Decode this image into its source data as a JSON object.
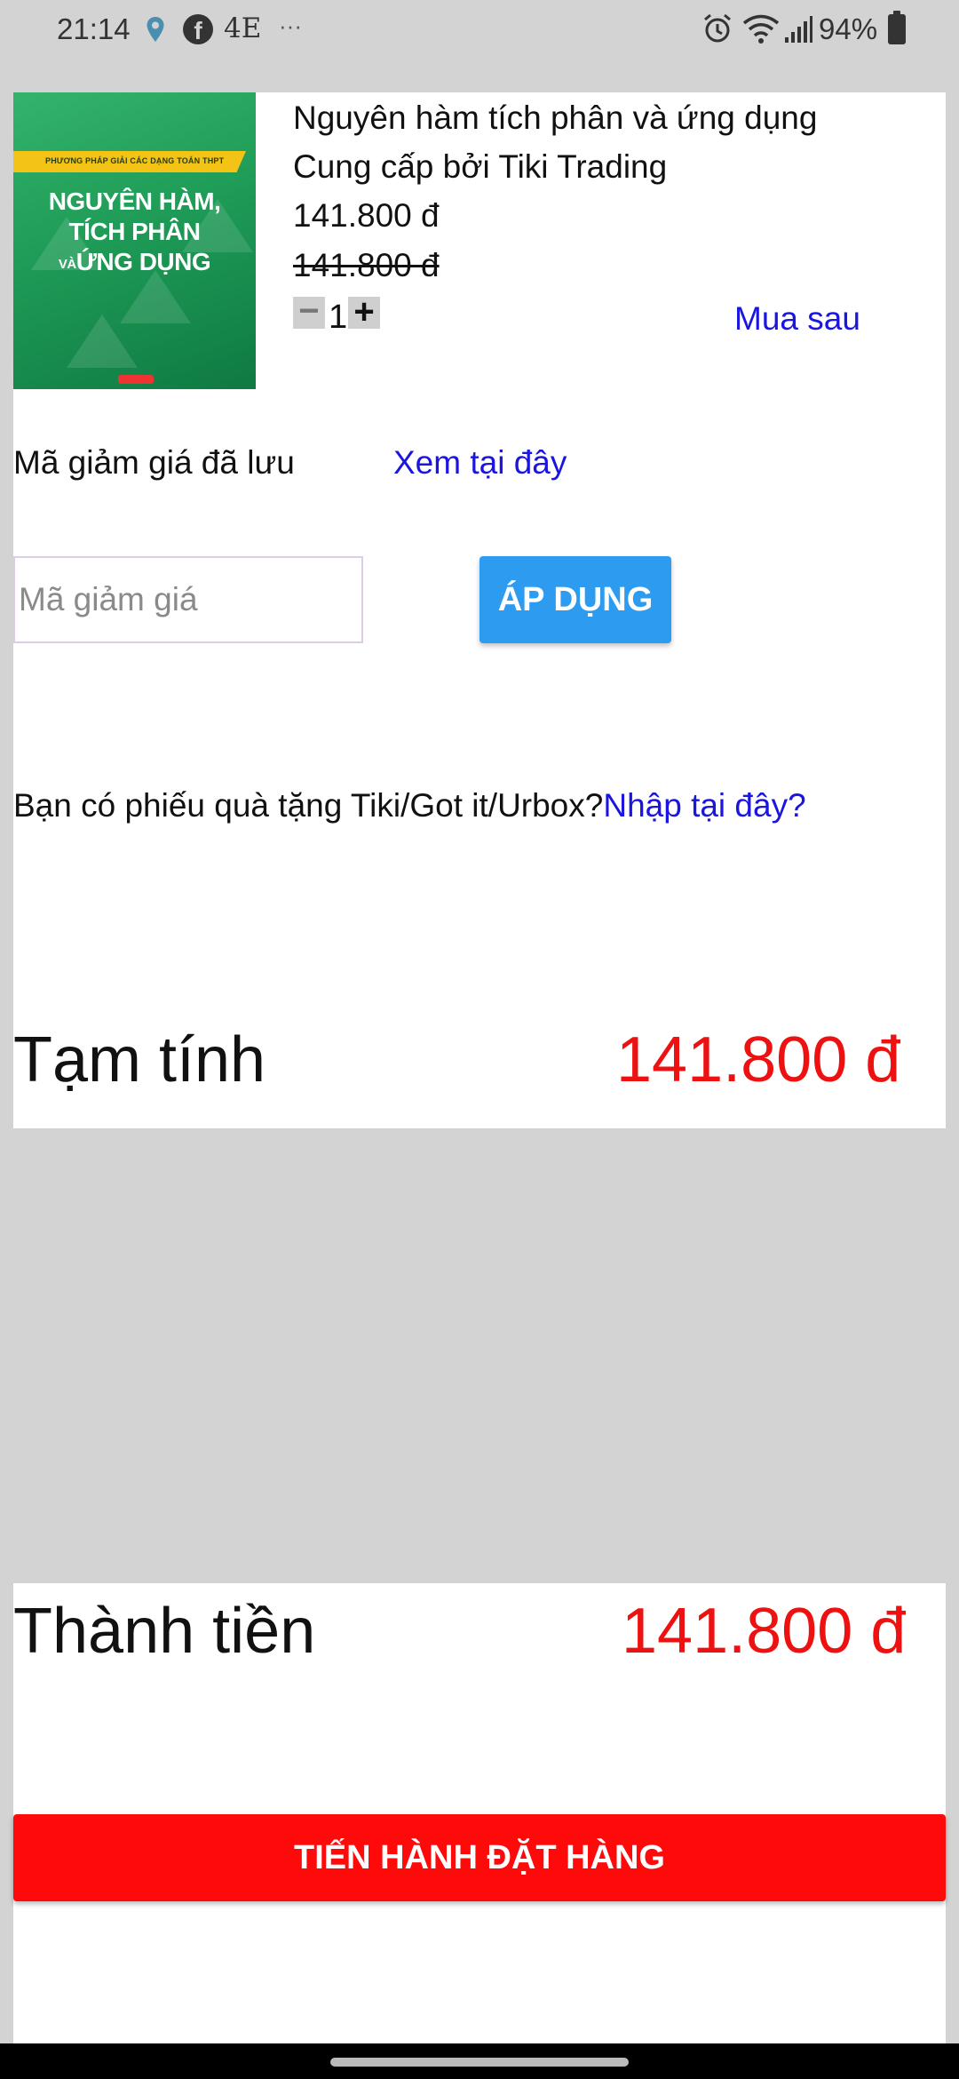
{
  "status_bar": {
    "time": "21:14",
    "network_label": "4E",
    "more": "···",
    "battery": "94%",
    "icons": [
      "location-icon",
      "facebook-icon",
      "alarm-icon",
      "wifi-icon",
      "signal-icon",
      "battery-icon"
    ]
  },
  "product": {
    "cover": {
      "band_text": "PHƯƠNG PHÁP GIẢI CÁC DẠNG TOÁN THPT",
      "title_line1": "NGUYÊN HÀM,",
      "title_line2": "TÍCH PHÂN",
      "title_line3_small": "VÀ",
      "title_line3": "ỨNG DỤNG"
    },
    "title": "Nguyên hàm tích phân và ứng dụng",
    "seller": "Cung cấp bởi Tiki Trading",
    "price": "141.800 đ",
    "original_price": "141.800 đ",
    "quantity": "1",
    "minus": "−",
    "plus": "+",
    "buy_later": "Mua sau"
  },
  "coupon": {
    "saved_label": "Mã giảm giá đã lưu",
    "saved_link": "Xem tại đây",
    "input_placeholder": "Mã giảm giá",
    "apply_label": "ÁP DỤNG"
  },
  "gift": {
    "text": "Bạn có phiếu quà tặng Tiki/Got it/Urbox?",
    "link": "Nhập tại đây?"
  },
  "subtotal": {
    "label": "Tạm tính",
    "value": "141.800 đ"
  },
  "total": {
    "label": "Thành tiền",
    "value": "141.800 đ"
  },
  "checkout": {
    "label": "TIẾN HÀNH ĐẶT HÀNG"
  },
  "colors": {
    "accent_blue": "#2d9cf0",
    "link_blue": "#1a16e0",
    "price_red": "#ee1111",
    "checkout_red": "#ff0a0a"
  }
}
